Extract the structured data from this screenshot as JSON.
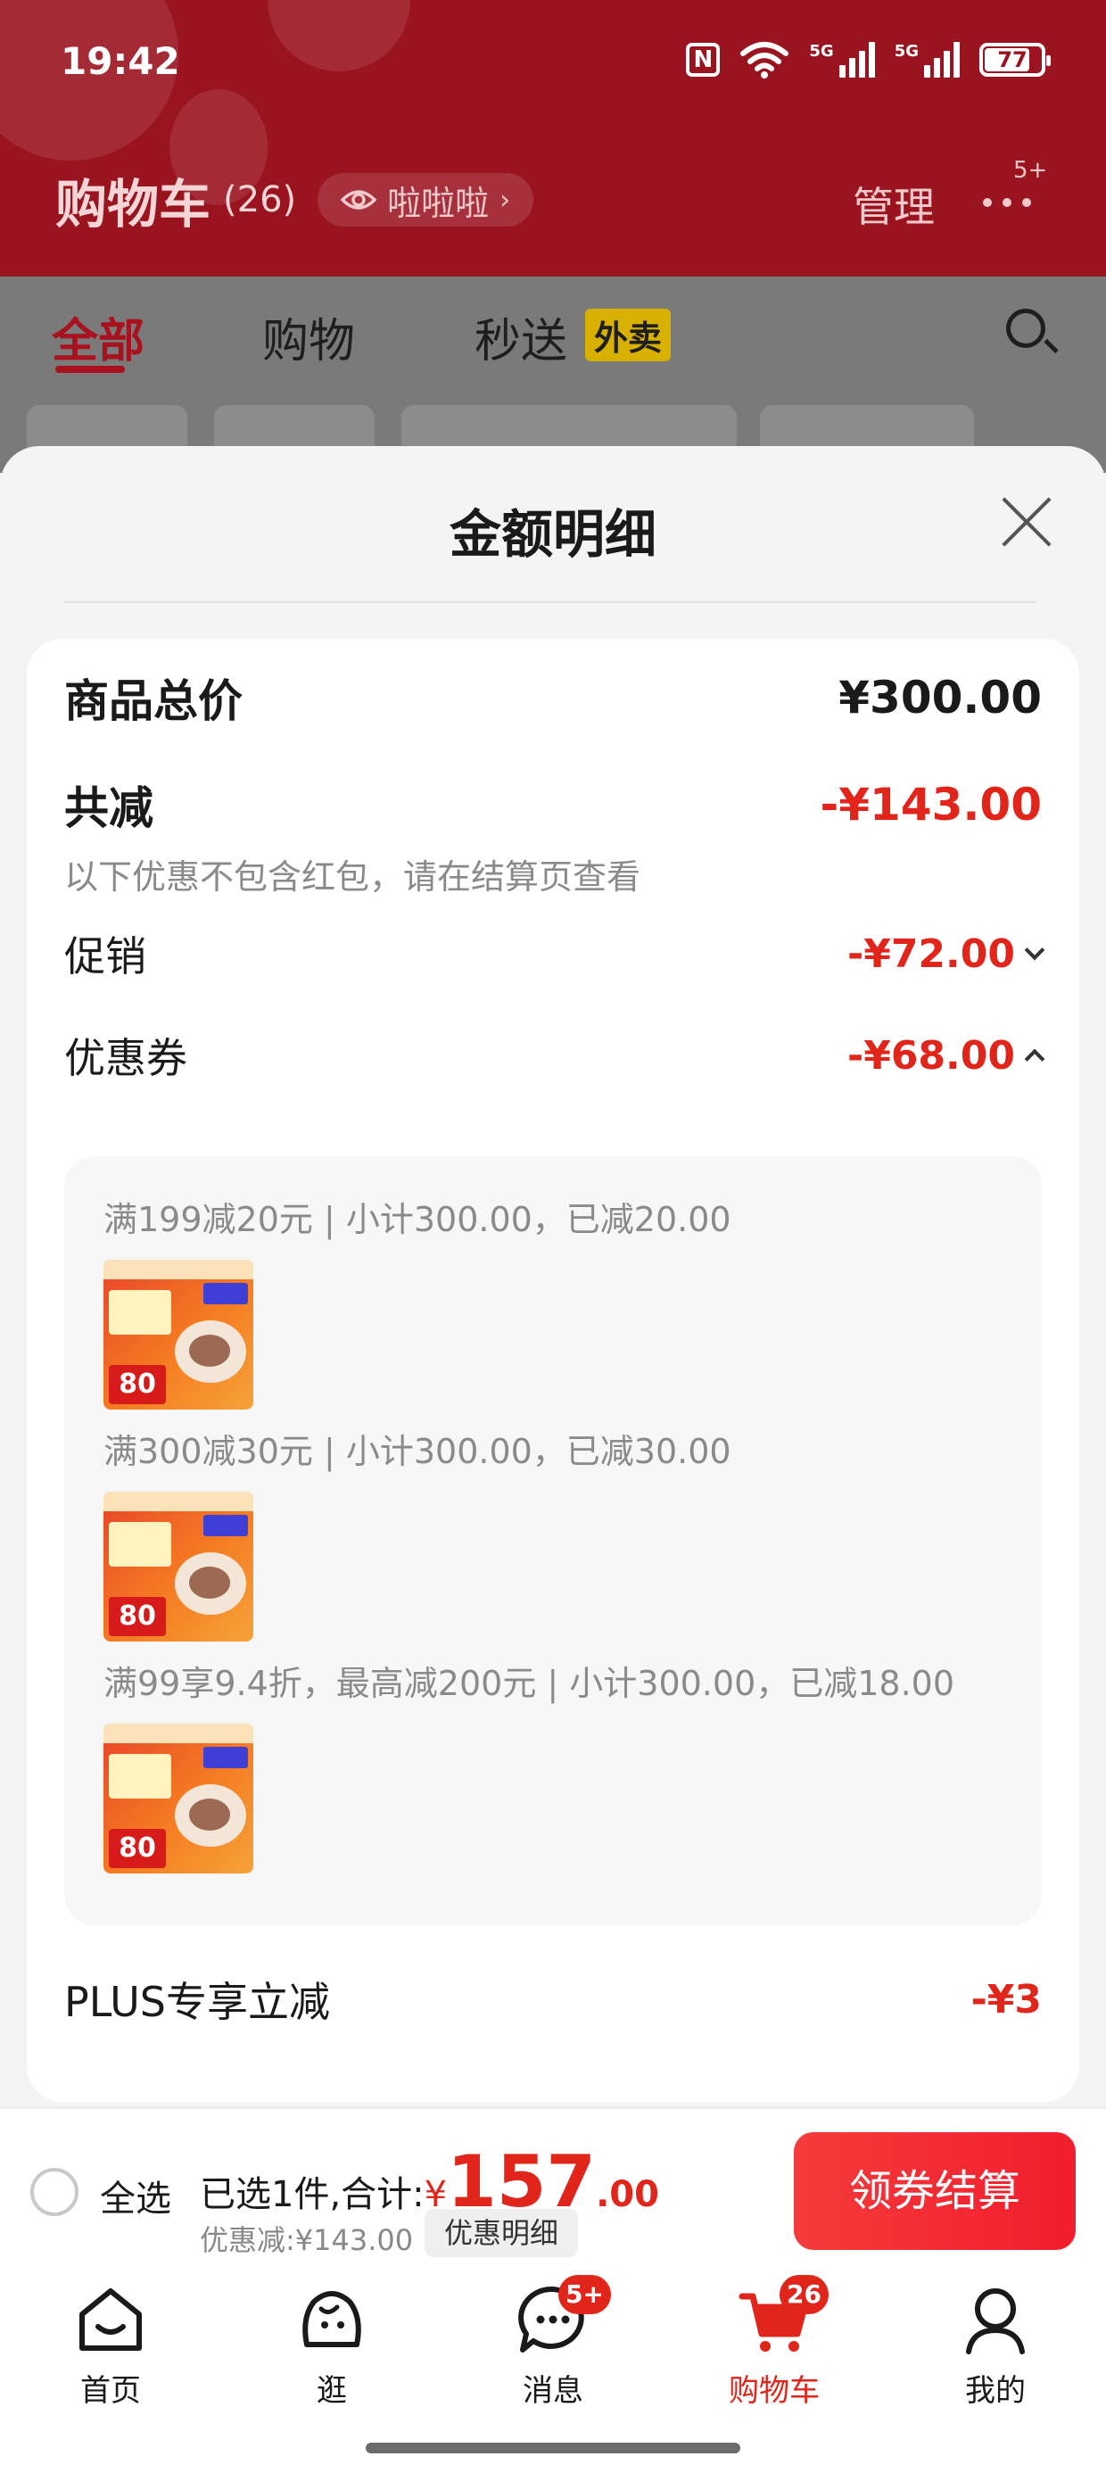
{
  "status": {
    "time": "19:42",
    "battery": "77",
    "net1": "5G",
    "net2": "5G"
  },
  "header": {
    "title": "购物车",
    "count": "(26)",
    "pill_label": "啦啦啦",
    "manage": "管理",
    "more_badge": "5+"
  },
  "tabs": [
    {
      "label": "全部"
    },
    {
      "label": "购物"
    },
    {
      "label": "秒送"
    }
  ],
  "tabs_extra": {
    "waimai": "外卖"
  },
  "modal": {
    "title": "金额明细",
    "total_label": "商品总价",
    "total_amount": "¥300.00",
    "reduce_label": "共减",
    "reduce_amount": "-¥143.00",
    "reduce_note": "以下优惠不包含红包，请在结算页查看",
    "promo_label": "促销",
    "promo_amount": "-¥72.00",
    "coupon_label": "优惠券",
    "coupon_amount": "-¥68.00",
    "coupons": [
      {
        "text": "满199减20元 | 小计300.00，已减20.00",
        "thumb_price": "80"
      },
      {
        "text": "满300减30元 | 小计300.00，已减30.00",
        "thumb_price": "80"
      },
      {
        "text": "满99享9.4折，最高减200元 | 小计300.00，已减18.00",
        "thumb_price": "80"
      }
    ],
    "plus_label": "PLUS专享立减",
    "plus_amount": "-¥3"
  },
  "checkout": {
    "select_all": "全选",
    "selected_prefix": "已选1件,合计:",
    "yen": "¥",
    "total_int": "157",
    "total_dec": ".00",
    "discount_text": "优惠减:¥143.00",
    "detail_button": "优惠明细",
    "pay_button": "领券结算"
  },
  "tabbar": [
    {
      "label": "首页",
      "icon": "home-icon"
    },
    {
      "label": "逛",
      "icon": "browse-icon"
    },
    {
      "label": "消息",
      "icon": "message-icon",
      "badge": "5+"
    },
    {
      "label": "购物车",
      "icon": "cart-icon",
      "badge": "26"
    },
    {
      "label": "我的",
      "icon": "profile-icon"
    }
  ],
  "colors": {
    "header_red": "#9a1420",
    "accent_red": "#e1251b"
  }
}
